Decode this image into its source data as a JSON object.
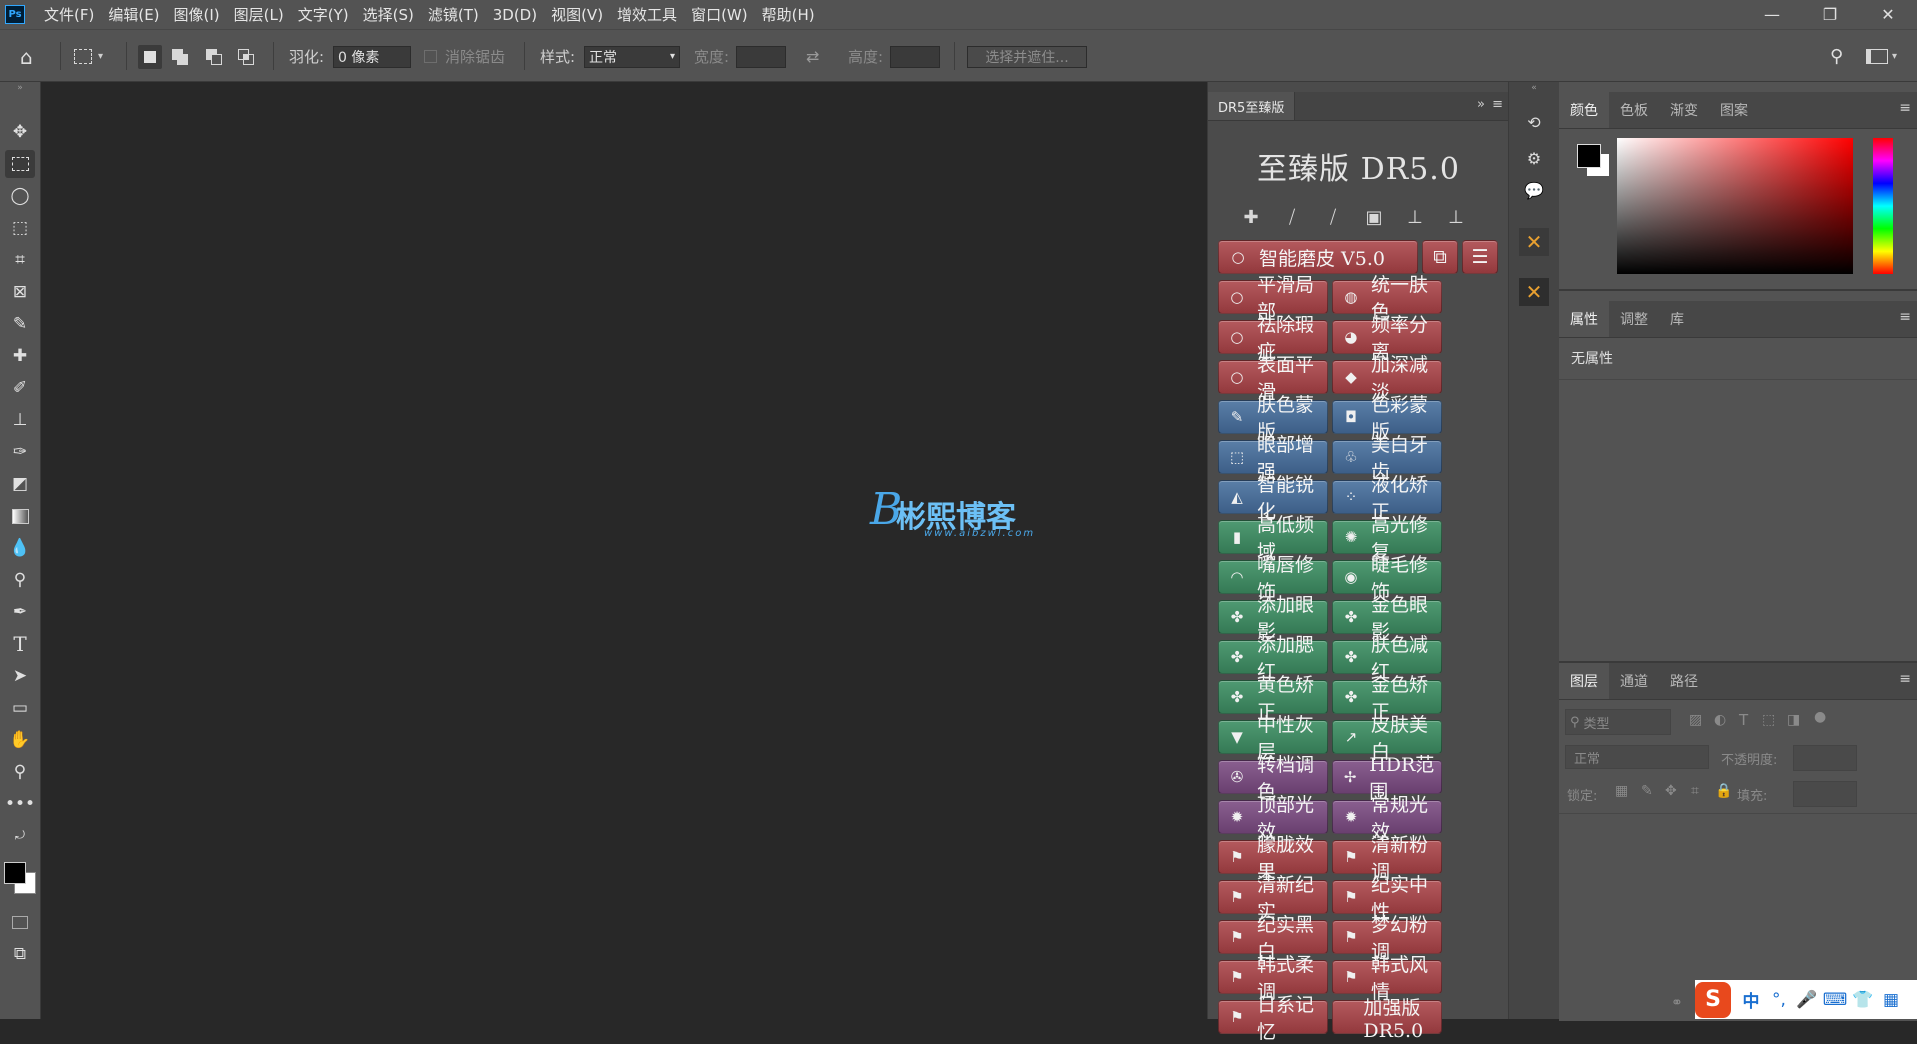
{
  "menu": {
    "logo": "Ps",
    "items": [
      "文件(F)",
      "编辑(E)",
      "图像(I)",
      "图层(L)",
      "文字(Y)",
      "选择(S)",
      "滤镜(T)",
      "3D(D)",
      "视图(V)",
      "增效工具",
      "窗口(W)",
      "帮助(H)"
    ],
    "min": "—",
    "restore": "❐",
    "close": "✕"
  },
  "options": {
    "feather_label": "羽化:",
    "feather_value": "0 像素",
    "antialias_label": "消除锯齿",
    "style_label": "样式:",
    "style_value": "正常",
    "width_label": "宽度:",
    "height_label": "高度:",
    "select_mask": "选择并遮住..."
  },
  "watermark": {
    "title": "彬熙博客",
    "letter": "B",
    "url": "www.aibzwl.com"
  },
  "dr5": {
    "tab_label": "DR5至臻版",
    "title": "至臻版 DR5.0",
    "top_button": "智能磨皮 V5.0",
    "buttons": [
      {
        "label": "平滑局部",
        "icon": "○",
        "color": "red"
      },
      {
        "label": "统一肤色",
        "icon": "◍",
        "color": "red"
      },
      {
        "label": "祛除瑕疵",
        "icon": "○",
        "color": "red"
      },
      {
        "label": "频率分离",
        "icon": "◕",
        "color": "red"
      },
      {
        "label": "表面平滑",
        "icon": "○",
        "color": "red"
      },
      {
        "label": "加深减淡",
        "icon": "◆",
        "color": "red"
      },
      {
        "label": "肤色蒙版",
        "icon": "✎",
        "color": "blue"
      },
      {
        "label": "色彩蒙版",
        "icon": "◘",
        "color": "blue"
      },
      {
        "label": "眼部增强",
        "icon": "⬚",
        "color": "blue"
      },
      {
        "label": "美白牙齿",
        "icon": "♧",
        "color": "blue"
      },
      {
        "label": "智能锐化",
        "icon": "◭",
        "color": "blue"
      },
      {
        "label": "液化矫正",
        "icon": "⁘",
        "color": "blue"
      },
      {
        "label": "高低频域",
        "icon": "▮",
        "color": "green"
      },
      {
        "label": "高光修复",
        "icon": "✺",
        "color": "green"
      },
      {
        "label": "嘴唇修饰",
        "icon": "◠",
        "color": "green"
      },
      {
        "label": "睫毛修饰",
        "icon": "◉",
        "color": "green"
      },
      {
        "label": "添加眼影",
        "icon": "✤",
        "color": "green"
      },
      {
        "label": "金色眼影",
        "icon": "✤",
        "color": "green"
      },
      {
        "label": "添加腮红",
        "icon": "✤",
        "color": "green"
      },
      {
        "label": "肤色减红",
        "icon": "✤",
        "color": "green"
      },
      {
        "label": "黄色矫正",
        "icon": "✤",
        "color": "green"
      },
      {
        "label": "金色矫正",
        "icon": "✤",
        "color": "green"
      },
      {
        "label": "中性灰层",
        "icon": "▼",
        "color": "green"
      },
      {
        "label": "皮肤美白",
        "icon": "↗",
        "color": "green"
      },
      {
        "label": "转档调色",
        "icon": "✇",
        "color": "purple"
      },
      {
        "label": "HDR范围",
        "icon": "✢",
        "color": "purple"
      },
      {
        "label": "顶部光效",
        "icon": "✹",
        "color": "purple"
      },
      {
        "label": "常规光效",
        "icon": "✹",
        "color": "purple"
      },
      {
        "label": "朦胧效果",
        "icon": "⚑",
        "color": "red"
      },
      {
        "label": "清新粉调",
        "icon": "⚑",
        "color": "red"
      },
      {
        "label": "清新纪实",
        "icon": "⚑",
        "color": "red"
      },
      {
        "label": "纪实中性",
        "icon": "⚑",
        "color": "red"
      },
      {
        "label": "纪实黑白",
        "icon": "⚑",
        "color": "red"
      },
      {
        "label": "梦幻粉调",
        "icon": "⚑",
        "color": "red"
      },
      {
        "label": "韩式柔调",
        "icon": "⚑",
        "color": "red"
      },
      {
        "label": "韩式风情",
        "icon": "⚑",
        "color": "red"
      },
      {
        "label": "日系记忆",
        "icon": "⚑",
        "color": "red"
      },
      {
        "label": "加强版 DR5.0",
        "icon": "",
        "color": "red"
      }
    ],
    "colors": {
      "red": "#a34a4e",
      "blue": "#4b6f98",
      "green": "#428a63",
      "purple": "#7a5080"
    }
  },
  "color_panel": {
    "tabs": [
      "颜色",
      "色板",
      "渐变",
      "图案"
    ]
  },
  "properties_panel": {
    "tabs": [
      "属性",
      "调整",
      "库"
    ],
    "empty_text": "无属性"
  },
  "layers_panel": {
    "tabs": [
      "图层",
      "通道",
      "路径"
    ],
    "filter_placeholder": "类型",
    "blend_mode": "正常",
    "opacity_label": "不透明度:",
    "lock_label": "锁定:",
    "fill_label": "填充:"
  },
  "tray": {
    "ime": "中",
    "punct": "°,"
  }
}
